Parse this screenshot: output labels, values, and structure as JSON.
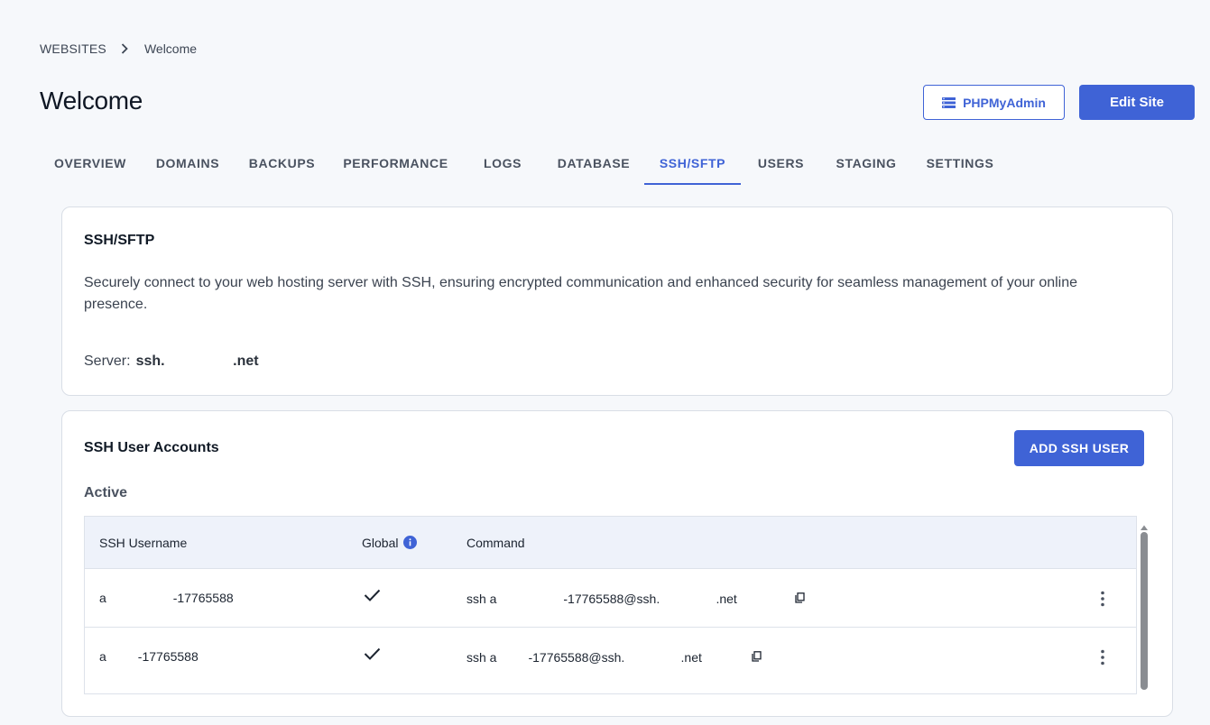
{
  "breadcrumb": {
    "root": "WEBSITES",
    "current": "Welcome"
  },
  "page_title": "Welcome",
  "header_buttons": {
    "phpmyadmin": "PHPMyAdmin",
    "edit_site": "Edit Site"
  },
  "tabs": [
    {
      "label": "OVERVIEW"
    },
    {
      "label": "DOMAINS"
    },
    {
      "label": "BACKUPS"
    },
    {
      "label": "PERFORMANCE"
    },
    {
      "label": "LOGS"
    },
    {
      "label": "DATABASE"
    },
    {
      "label": "SSH/SFTP",
      "active": true
    },
    {
      "label": "USERS"
    },
    {
      "label": "STAGING"
    },
    {
      "label": "SETTINGS"
    }
  ],
  "ssh_card": {
    "title": "SSH/SFTP",
    "description": "Securely connect to your web hosting server with SSH, ensuring encrypted communication and enhanced security for seamless management of your online presence.",
    "server_label": "Server:",
    "server_value": "ssh.                 .net"
  },
  "accounts_card": {
    "title": "SSH User Accounts",
    "add_button": "ADD SSH USER",
    "section_label": "Active",
    "columns": {
      "username": "SSH Username",
      "global": "Global",
      "command": "Command"
    },
    "rows": [
      {
        "username": "a                   -17765588",
        "command": "ssh a                   -17765588@ssh.                .net"
      },
      {
        "username": "a         -17765588",
        "command": "ssh a         -17765588@ssh.                .net"
      }
    ]
  },
  "icons": {
    "breadcrumb_sep": "chevron-right-icon",
    "phpmyadmin": "database-icon",
    "global_info": "info-icon",
    "global_check": "check-icon",
    "copy": "copy-icon",
    "row_menu": "more-vertical-icon"
  },
  "colors": {
    "accent": "#3f63d6",
    "background": "#f6f8fb",
    "table_header": "#eef2fa"
  }
}
